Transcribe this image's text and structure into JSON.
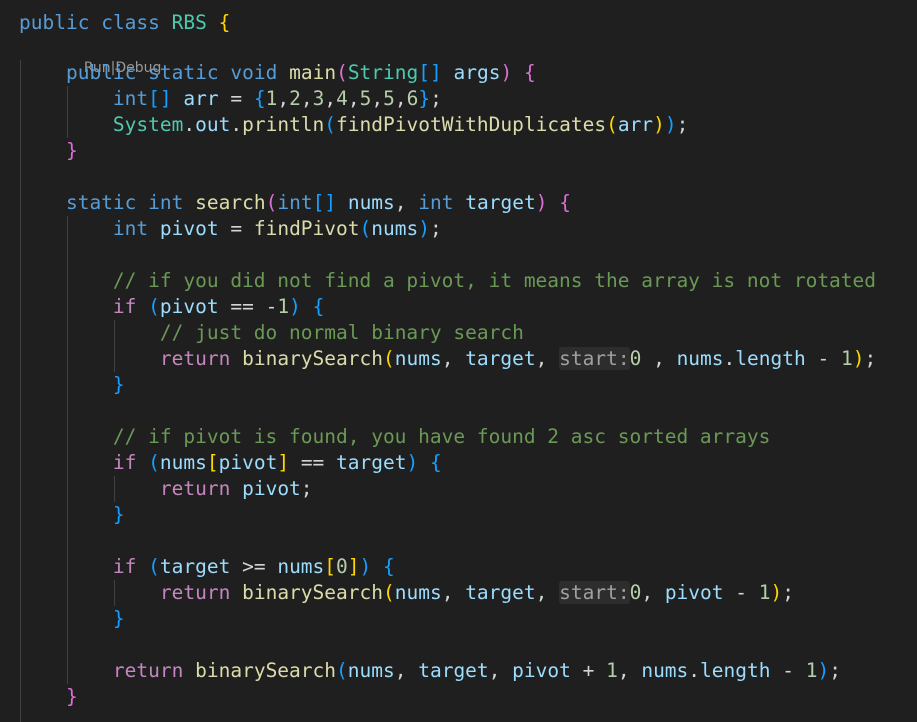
{
  "editor": {
    "codelens": {
      "run": "Run",
      "separator": "|",
      "debug": "Debug"
    },
    "lines": [
      {
        "tokens": [
          {
            "t": "public",
            "c": "kw"
          },
          {
            "t": " ",
            "c": "op"
          },
          {
            "t": "class",
            "c": "kw"
          },
          {
            "t": " ",
            "c": "op"
          },
          {
            "t": "RBS",
            "c": "type"
          },
          {
            "t": " ",
            "c": "op"
          },
          {
            "t": "{",
            "c": "b1"
          }
        ]
      },
      {
        "tokens": [
          {
            "t": "    ",
            "c": "op"
          },
          {
            "t": "public",
            "c": "kw"
          },
          {
            "t": " ",
            "c": "op"
          },
          {
            "t": "static",
            "c": "kw"
          },
          {
            "t": " ",
            "c": "op"
          },
          {
            "t": "void",
            "c": "kw"
          },
          {
            "t": " ",
            "c": "op"
          },
          {
            "t": "main",
            "c": "fn"
          },
          {
            "t": "(",
            "c": "b2"
          },
          {
            "t": "String",
            "c": "type"
          },
          {
            "t": "[]",
            "c": "b3"
          },
          {
            "t": " ",
            "c": "op"
          },
          {
            "t": "args",
            "c": "var"
          },
          {
            "t": ")",
            "c": "b2"
          },
          {
            "t": " ",
            "c": "op"
          },
          {
            "t": "{",
            "c": "b2"
          }
        ]
      },
      {
        "tokens": [
          {
            "t": "        ",
            "c": "op"
          },
          {
            "t": "int",
            "c": "kw"
          },
          {
            "t": "[]",
            "c": "b3"
          },
          {
            "t": " ",
            "c": "op"
          },
          {
            "t": "arr",
            "c": "var"
          },
          {
            "t": " = ",
            "c": "op"
          },
          {
            "t": "{",
            "c": "b3"
          },
          {
            "t": "1",
            "c": "num"
          },
          {
            "t": ",",
            "c": "op"
          },
          {
            "t": "2",
            "c": "num"
          },
          {
            "t": ",",
            "c": "op"
          },
          {
            "t": "3",
            "c": "num"
          },
          {
            "t": ",",
            "c": "op"
          },
          {
            "t": "4",
            "c": "num"
          },
          {
            "t": ",",
            "c": "op"
          },
          {
            "t": "5",
            "c": "num"
          },
          {
            "t": ",",
            "c": "op"
          },
          {
            "t": "5",
            "c": "num"
          },
          {
            "t": ",",
            "c": "op"
          },
          {
            "t": "6",
            "c": "num"
          },
          {
            "t": "}",
            "c": "b3"
          },
          {
            "t": ";",
            "c": "op"
          }
        ]
      },
      {
        "tokens": [
          {
            "t": "        ",
            "c": "op"
          },
          {
            "t": "System",
            "c": "type"
          },
          {
            "t": ".",
            "c": "op"
          },
          {
            "t": "out",
            "c": "var"
          },
          {
            "t": ".",
            "c": "op"
          },
          {
            "t": "println",
            "c": "fn"
          },
          {
            "t": "(",
            "c": "b3"
          },
          {
            "t": "findPivotWithDuplicates",
            "c": "fn"
          },
          {
            "t": "(",
            "c": "b1"
          },
          {
            "t": "arr",
            "c": "var"
          },
          {
            "t": ")",
            "c": "b1"
          },
          {
            "t": ")",
            "c": "b3"
          },
          {
            "t": ";",
            "c": "op"
          }
        ]
      },
      {
        "tokens": [
          {
            "t": "    ",
            "c": "op"
          },
          {
            "t": "}",
            "c": "b2"
          }
        ]
      },
      {
        "tokens": []
      },
      {
        "tokens": [
          {
            "t": "    ",
            "c": "op"
          },
          {
            "t": "static",
            "c": "kw"
          },
          {
            "t": " ",
            "c": "op"
          },
          {
            "t": "int",
            "c": "kw"
          },
          {
            "t": " ",
            "c": "op"
          },
          {
            "t": "search",
            "c": "fn"
          },
          {
            "t": "(",
            "c": "b2"
          },
          {
            "t": "int",
            "c": "kw"
          },
          {
            "t": "[]",
            "c": "b3"
          },
          {
            "t": " ",
            "c": "op"
          },
          {
            "t": "nums",
            "c": "var"
          },
          {
            "t": ", ",
            "c": "op"
          },
          {
            "t": "int",
            "c": "kw"
          },
          {
            "t": " ",
            "c": "op"
          },
          {
            "t": "target",
            "c": "var"
          },
          {
            "t": ")",
            "c": "b2"
          },
          {
            "t": " ",
            "c": "op"
          },
          {
            "t": "{",
            "c": "b2"
          }
        ]
      },
      {
        "tokens": [
          {
            "t": "        ",
            "c": "op"
          },
          {
            "t": "int",
            "c": "kw"
          },
          {
            "t": " ",
            "c": "op"
          },
          {
            "t": "pivot",
            "c": "var"
          },
          {
            "t": " = ",
            "c": "op"
          },
          {
            "t": "findPivot",
            "c": "fn"
          },
          {
            "t": "(",
            "c": "b3"
          },
          {
            "t": "nums",
            "c": "var"
          },
          {
            "t": ")",
            "c": "b3"
          },
          {
            "t": ";",
            "c": "op"
          }
        ]
      },
      {
        "tokens": []
      },
      {
        "tokens": [
          {
            "t": "        ",
            "c": "op"
          },
          {
            "t": "// if you did not find a pivot, it means the array is not rotated",
            "c": "cmt"
          }
        ]
      },
      {
        "tokens": [
          {
            "t": "        ",
            "c": "op"
          },
          {
            "t": "if",
            "c": "ctl"
          },
          {
            "t": " ",
            "c": "op"
          },
          {
            "t": "(",
            "c": "b3"
          },
          {
            "t": "pivot",
            "c": "var"
          },
          {
            "t": " == ",
            "c": "op"
          },
          {
            "t": "-",
            "c": "op"
          },
          {
            "t": "1",
            "c": "num"
          },
          {
            "t": ")",
            "c": "b3"
          },
          {
            "t": " ",
            "c": "op"
          },
          {
            "t": "{",
            "c": "b3"
          }
        ]
      },
      {
        "tokens": [
          {
            "t": "            ",
            "c": "op"
          },
          {
            "t": "// just do normal binary search",
            "c": "cmt"
          }
        ]
      },
      {
        "tokens": [
          {
            "t": "            ",
            "c": "op"
          },
          {
            "t": "return",
            "c": "ctl"
          },
          {
            "t": " ",
            "c": "op"
          },
          {
            "t": "binarySearch",
            "c": "fn"
          },
          {
            "t": "(",
            "c": "b1"
          },
          {
            "t": "nums",
            "c": "var"
          },
          {
            "t": ", ",
            "c": "op"
          },
          {
            "t": "target",
            "c": "var"
          },
          {
            "t": ", ",
            "c": "op"
          },
          {
            "t": "start:",
            "c": "hint"
          },
          {
            "t": "0",
            "c": "num"
          },
          {
            "t": " , ",
            "c": "op"
          },
          {
            "t": "nums",
            "c": "var"
          },
          {
            "t": ".",
            "c": "op"
          },
          {
            "t": "length",
            "c": "var"
          },
          {
            "t": " - ",
            "c": "op"
          },
          {
            "t": "1",
            "c": "num"
          },
          {
            "t": ")",
            "c": "b1"
          },
          {
            "t": ";",
            "c": "op"
          }
        ]
      },
      {
        "tokens": [
          {
            "t": "        ",
            "c": "op"
          },
          {
            "t": "}",
            "c": "b3"
          }
        ]
      },
      {
        "tokens": []
      },
      {
        "tokens": [
          {
            "t": "        ",
            "c": "op"
          },
          {
            "t": "// if pivot is found, you have found 2 asc sorted arrays",
            "c": "cmt"
          }
        ]
      },
      {
        "tokens": [
          {
            "t": "        ",
            "c": "op"
          },
          {
            "t": "if",
            "c": "ctl"
          },
          {
            "t": " ",
            "c": "op"
          },
          {
            "t": "(",
            "c": "b3"
          },
          {
            "t": "nums",
            "c": "var"
          },
          {
            "t": "[",
            "c": "b1"
          },
          {
            "t": "pivot",
            "c": "var"
          },
          {
            "t": "]",
            "c": "b1"
          },
          {
            "t": " == ",
            "c": "op"
          },
          {
            "t": "target",
            "c": "var"
          },
          {
            "t": ")",
            "c": "b3"
          },
          {
            "t": " ",
            "c": "op"
          },
          {
            "t": "{",
            "c": "b3"
          }
        ]
      },
      {
        "tokens": [
          {
            "t": "            ",
            "c": "op"
          },
          {
            "t": "return",
            "c": "ctl"
          },
          {
            "t": " ",
            "c": "op"
          },
          {
            "t": "pivot",
            "c": "var"
          },
          {
            "t": ";",
            "c": "op"
          }
        ]
      },
      {
        "tokens": [
          {
            "t": "        ",
            "c": "op"
          },
          {
            "t": "}",
            "c": "b3"
          }
        ]
      },
      {
        "tokens": []
      },
      {
        "tokens": [
          {
            "t": "        ",
            "c": "op"
          },
          {
            "t": "if",
            "c": "ctl"
          },
          {
            "t": " ",
            "c": "op"
          },
          {
            "t": "(",
            "c": "b3"
          },
          {
            "t": "target",
            "c": "var"
          },
          {
            "t": " >= ",
            "c": "op"
          },
          {
            "t": "nums",
            "c": "var"
          },
          {
            "t": "[",
            "c": "b1"
          },
          {
            "t": "0",
            "c": "num"
          },
          {
            "t": "]",
            "c": "b1"
          },
          {
            "t": ")",
            "c": "b3"
          },
          {
            "t": " ",
            "c": "op"
          },
          {
            "t": "{",
            "c": "b3"
          }
        ]
      },
      {
        "tokens": [
          {
            "t": "            ",
            "c": "op"
          },
          {
            "t": "return",
            "c": "ctl"
          },
          {
            "t": " ",
            "c": "op"
          },
          {
            "t": "binarySearch",
            "c": "fn"
          },
          {
            "t": "(",
            "c": "b1"
          },
          {
            "t": "nums",
            "c": "var"
          },
          {
            "t": ", ",
            "c": "op"
          },
          {
            "t": "target",
            "c": "var"
          },
          {
            "t": ", ",
            "c": "op"
          },
          {
            "t": "start:",
            "c": "hint"
          },
          {
            "t": "0",
            "c": "num"
          },
          {
            "t": ", ",
            "c": "op"
          },
          {
            "t": "pivot",
            "c": "var"
          },
          {
            "t": " - ",
            "c": "op"
          },
          {
            "t": "1",
            "c": "num"
          },
          {
            "t": ")",
            "c": "b1"
          },
          {
            "t": ";",
            "c": "op"
          }
        ]
      },
      {
        "tokens": [
          {
            "t": "        ",
            "c": "op"
          },
          {
            "t": "}",
            "c": "b3"
          }
        ]
      },
      {
        "tokens": []
      },
      {
        "tokens": [
          {
            "t": "        ",
            "c": "op"
          },
          {
            "t": "return",
            "c": "ctl"
          },
          {
            "t": " ",
            "c": "op"
          },
          {
            "t": "binarySearch",
            "c": "fn"
          },
          {
            "t": "(",
            "c": "b3"
          },
          {
            "t": "nums",
            "c": "var"
          },
          {
            "t": ", ",
            "c": "op"
          },
          {
            "t": "target",
            "c": "var"
          },
          {
            "t": ", ",
            "c": "op"
          },
          {
            "t": "pivot",
            "c": "var"
          },
          {
            "t": " + ",
            "c": "op"
          },
          {
            "t": "1",
            "c": "num"
          },
          {
            "t": ", ",
            "c": "op"
          },
          {
            "t": "nums",
            "c": "var"
          },
          {
            "t": ".",
            "c": "op"
          },
          {
            "t": "length",
            "c": "var"
          },
          {
            "t": " - ",
            "c": "op"
          },
          {
            "t": "1",
            "c": "num"
          },
          {
            "t": ")",
            "c": "b3"
          },
          {
            "t": ";",
            "c": "op"
          }
        ]
      },
      {
        "tokens": [
          {
            "t": "    ",
            "c": "op"
          },
          {
            "t": "}",
            "c": "b2"
          }
        ]
      }
    ]
  }
}
